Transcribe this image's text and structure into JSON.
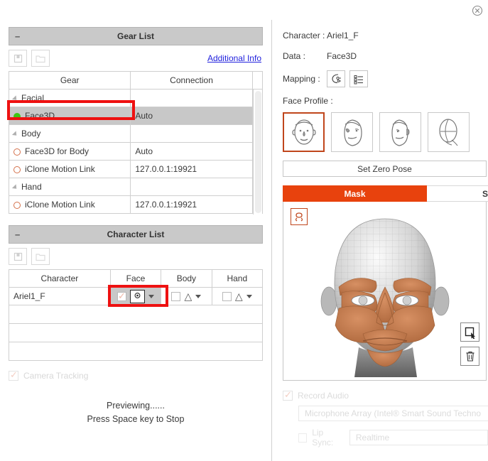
{
  "window": {
    "close_icon": "close-circle-icon"
  },
  "gear_panel": {
    "title": "Gear List",
    "collapse_glyph": "–",
    "save_icon": "save-icon",
    "open_icon": "folder-open-icon",
    "additional_info_link": "Additional Info",
    "columns": [
      "Gear",
      "Connection"
    ],
    "rows": [
      {
        "label": "Facial",
        "connection": "",
        "type": "group",
        "indent": 1
      },
      {
        "label": "Face3D",
        "connection": "Auto",
        "type": "item",
        "indent": 2,
        "status": "on",
        "selected": true
      },
      {
        "label": "Body",
        "connection": "",
        "type": "group",
        "indent": 1
      },
      {
        "label": "Face3D for Body",
        "connection": "Auto",
        "type": "item",
        "indent": 2,
        "status": "off",
        "selected": false
      },
      {
        "label": "iClone Motion Link",
        "connection": "127.0.0.1:19921",
        "type": "item",
        "indent": 2,
        "status": "off",
        "selected": false
      },
      {
        "label": "Hand",
        "connection": "",
        "type": "group",
        "indent": 1
      },
      {
        "label": "iClone Motion Link",
        "connection": "127.0.0.1:19921",
        "type": "item",
        "indent": 2,
        "status": "off",
        "selected": false
      }
    ]
  },
  "character_panel": {
    "title": "Character List",
    "collapse_glyph": "–",
    "save_icon": "save-icon",
    "open_icon": "folder-open-icon",
    "columns": [
      "Character",
      "Face",
      "Body",
      "Hand"
    ],
    "row": {
      "character": "Ariel1_F",
      "face_device_icon": "webcam-icon",
      "body_warning_icon": "warning-triangle-icon",
      "hand_warning_icon": "warning-triangle-icon",
      "dropdown_icon": "chevron-down-icon"
    }
  },
  "camera_tracking": {
    "label": "Camera Tracking",
    "checked": true,
    "enabled": false
  },
  "status": {
    "line1": "Previewing......",
    "line2": "Press Space key to Stop"
  },
  "details": {
    "character_label": "Character :",
    "character_value": "Ariel1_F",
    "data_label": "Data :",
    "data_value": "Face3D",
    "mapping_label": "Mapping :",
    "mapping_icons": [
      "face-mapping-icon",
      "list-mapping-icon"
    ],
    "face_profile_label": "Face Profile :",
    "profiles": [
      {
        "name": "profile-front-face",
        "selected": true
      },
      {
        "name": "profile-three-quarter-face",
        "selected": false
      },
      {
        "name": "profile-side-face",
        "selected": false
      },
      {
        "name": "profile-wireframe-face",
        "selected": false
      }
    ],
    "set_zero_pose": "Set Zero Pose"
  },
  "mask_panel": {
    "tabs": [
      {
        "label": "Mask",
        "active": true
      },
      {
        "label": "S",
        "active": false
      }
    ],
    "rotate_icon": "rotate-3d-icon",
    "select_icon": "marquee-select-icon",
    "delete_icon": "trash-icon",
    "accent_color": "#e8420d"
  },
  "audio": {
    "record_label": "Record Audio",
    "record_checked": true,
    "microphone": "Microphone Array (Intel® Smart Sound Techno",
    "lip_sync_label": "Lip Sync:",
    "lip_sync_value": "Realtime",
    "enabled": false
  }
}
